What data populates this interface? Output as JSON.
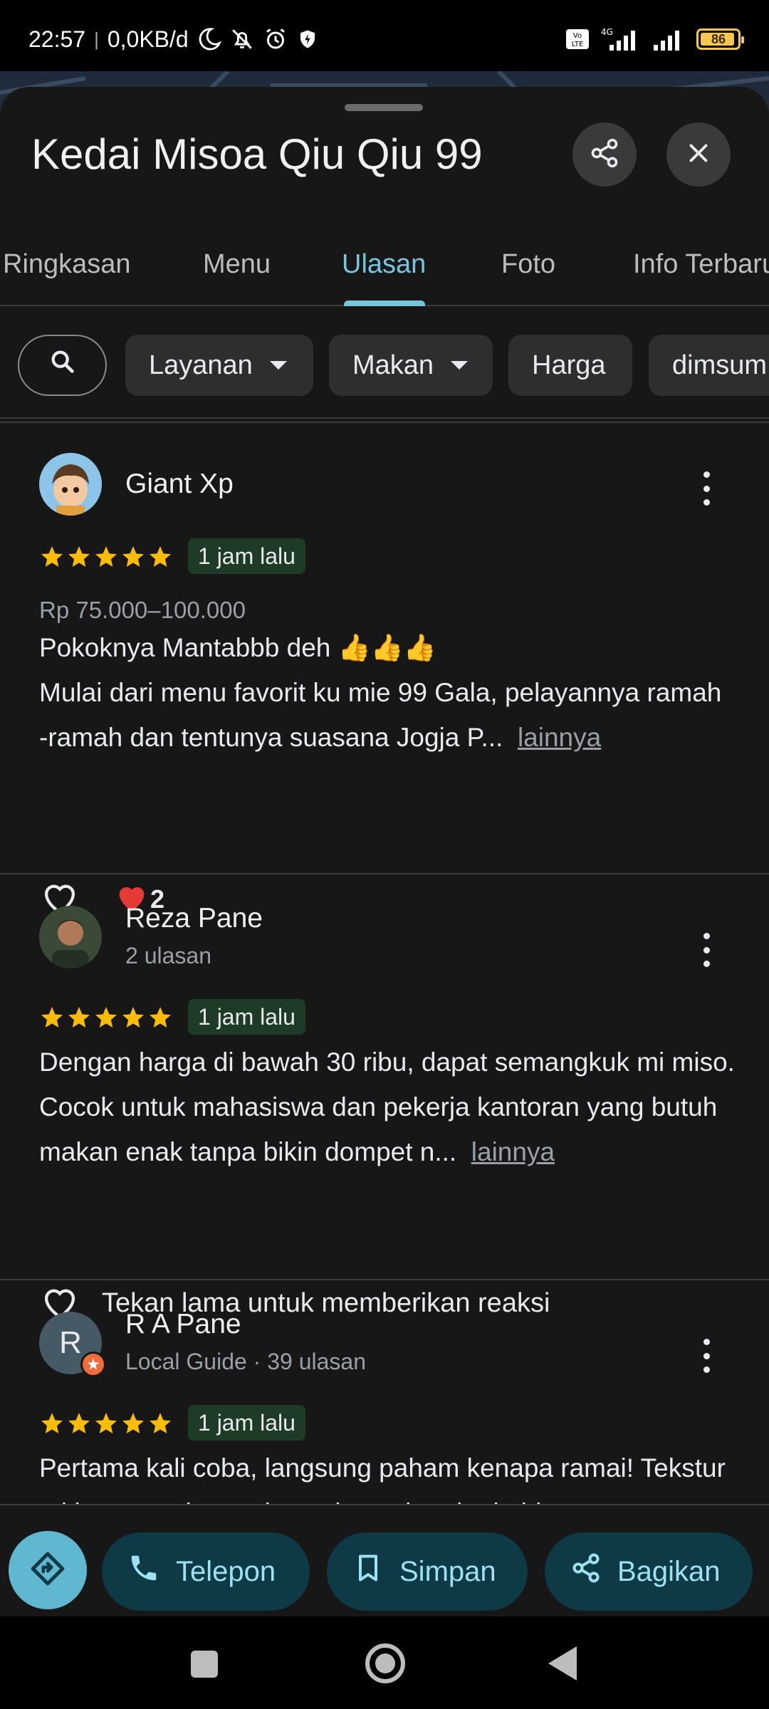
{
  "status": {
    "time": "22:57",
    "speed": "0,0KB/d",
    "battery": "86",
    "network": "4G",
    "volte": "Vo LTE",
    "icons": [
      "moon-icon",
      "bell-off-icon",
      "alarm-icon",
      "shield-icon",
      "volte-icon",
      "signal-icon",
      "signal-icon",
      "battery-icon"
    ]
  },
  "place": {
    "title": "Kedai Misoa Qiu Qiu 99"
  },
  "tabs": [
    "Ringkasan",
    "Menu",
    "Ulasan",
    "Foto",
    "Info Terbaru"
  ],
  "active_tab": "Ulasan",
  "chips": [
    "Layanan",
    "Makan",
    "Harga",
    "dimsum"
  ],
  "reviews": [
    {
      "name": "Giant Xp",
      "sub": "",
      "stars": 5,
      "time": "1 jam lalu",
      "price": "Rp 75.000–100.000",
      "line1": "Pokoknya Mantabbb deh 👍👍👍",
      "text": "Mulai dari menu favorit ku mie 99 Gala, pelayannya ramah -ramah dan tentunya suasana Jogja P...",
      "more": "lainnya",
      "reaction_count": "2"
    },
    {
      "name": "Reza Pane",
      "sub": "2 ulasan",
      "stars": 5,
      "time": "1 jam lalu",
      "text": "Dengan harga di bawah 30 ribu, dapat semangkuk mi miso. Cocok untuk mahasiswa dan pekerja kantoran yang butuh makan enak tanpa bikin dompet n...",
      "more": "lainnya",
      "react_hint": "Tekan lama untuk memberikan reaksi"
    },
    {
      "name": "R A Pane",
      "avatar_letter": "R",
      "sub": "Local Guide · 39 ulasan",
      "stars": 5,
      "time": "1 jam lalu",
      "text": "Pertama kali coba, langsung paham kenapa ramai! Tekstur mi homemade-nya kenyal pas, bumbu kaldunya"
    }
  ],
  "actions": {
    "call": "Telepon",
    "save": "Simpan",
    "share": "Bagikan"
  },
  "colors": {
    "accent": "#78c6dc",
    "sheet_bg": "#171717",
    "star": "#fbbc04",
    "badge_bg": "#1d3b26",
    "action_bg": "#0d3a44",
    "action_text": "#9ee1f2"
  }
}
